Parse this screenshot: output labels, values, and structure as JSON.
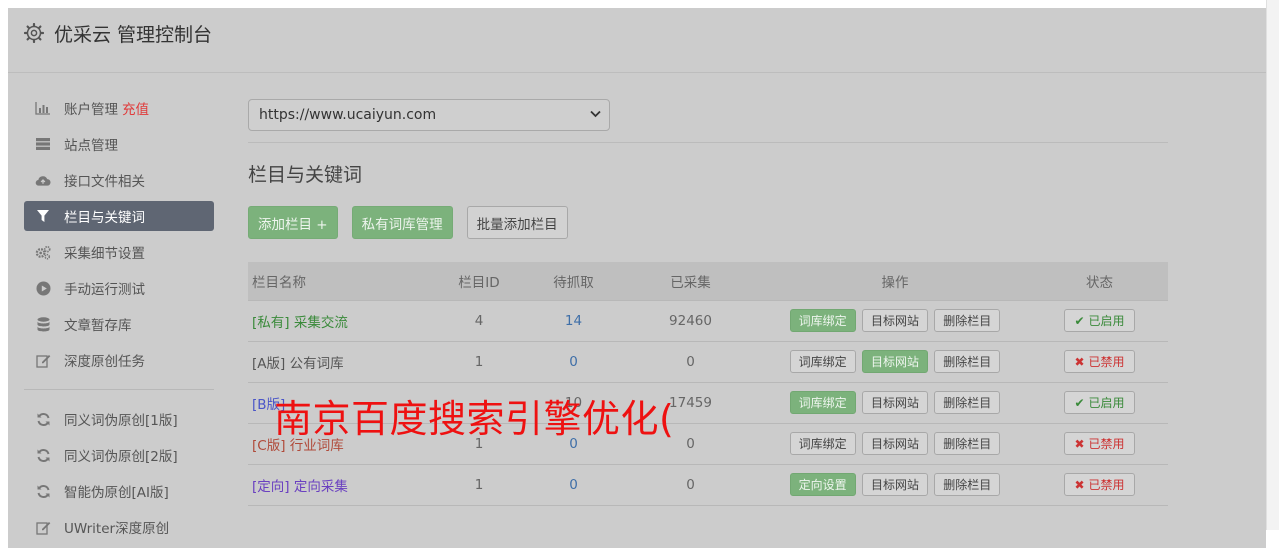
{
  "app": {
    "title": "优采云 管理控制台",
    "settings_icon": "gear-icon"
  },
  "sidebar": {
    "items": [
      {
        "label": "账户管理",
        "badge": "充值",
        "icon": "bar-chart-icon",
        "active": false
      },
      {
        "label": "站点管理",
        "icon": "server-icon",
        "active": false
      },
      {
        "label": "接口文件相关",
        "icon": "cloud-upload-icon",
        "active": false
      },
      {
        "label": "栏目与关键词",
        "icon": "filter-icon",
        "active": true
      },
      {
        "label": "采集细节设置",
        "icon": "cogs-icon",
        "active": false
      },
      {
        "label": "手动运行测试",
        "icon": "play-circle-icon",
        "active": false
      },
      {
        "label": "文章暂存库",
        "icon": "database-icon",
        "active": false
      },
      {
        "label": "深度原创任务",
        "icon": "edit-icon",
        "active": false
      }
    ],
    "items2": [
      {
        "label": "同义词伪原创[1版]",
        "icon": "refresh-icon"
      },
      {
        "label": "同义词伪原创[2版]",
        "icon": "refresh-icon"
      },
      {
        "label": "智能伪原创[AI版]",
        "icon": "refresh-icon"
      },
      {
        "label": "UWriter深度原创",
        "icon": "edit-icon"
      }
    ]
  },
  "main": {
    "site_select": "https://www.ucaiyun.com",
    "section_title": "栏目与关键词",
    "buttons": {
      "add_column": "添加栏目 +",
      "private_lib": "私有词库管理",
      "batch_add": "批量添加栏目"
    },
    "table": {
      "headers": [
        "栏目名称",
        "栏目ID",
        "待抓取",
        "已采集",
        "操作",
        "状态"
      ],
      "rows": [
        {
          "tag": "[私有]",
          "name": "采集交流",
          "id": "4",
          "pending": "14",
          "collected": "92460",
          "op1": "词库绑定",
          "op2": "目标网站",
          "op3": "删除栏目",
          "status": "已启用"
        },
        {
          "tag": "[A版]",
          "name": "公有词库",
          "id": "1",
          "pending": "0",
          "collected": "0",
          "op1": "词库绑定",
          "op2": "目标网站",
          "op3": "删除栏目",
          "status": "已禁用"
        },
        {
          "tag": "[B版]",
          "name": "",
          "id": "",
          "pending": "10",
          "collected": "17459",
          "op1": "词库绑定",
          "op2": "目标网站",
          "op3": "删除栏目",
          "status": "已启用"
        },
        {
          "tag": "[C版]",
          "name": "行业词库",
          "id": "1",
          "pending": "0",
          "collected": "0",
          "op1": "词库绑定",
          "op2": "目标网站",
          "op3": "删除栏目",
          "status": "已禁用"
        },
        {
          "tag": "[定向]",
          "name": "定向采集",
          "id": "1",
          "pending": "0",
          "collected": "0",
          "op1": "定向设置",
          "op2": "目标网站",
          "op3": "删除栏目",
          "status": "已禁用"
        }
      ]
    }
  },
  "overlay": {
    "watermark": "南京百度搜索引擎优化("
  },
  "colors": {
    "accent_green": "#7cb27c",
    "active_nav": "#5f6673",
    "danger": "#cc3333",
    "watermark": "#ee1111"
  }
}
